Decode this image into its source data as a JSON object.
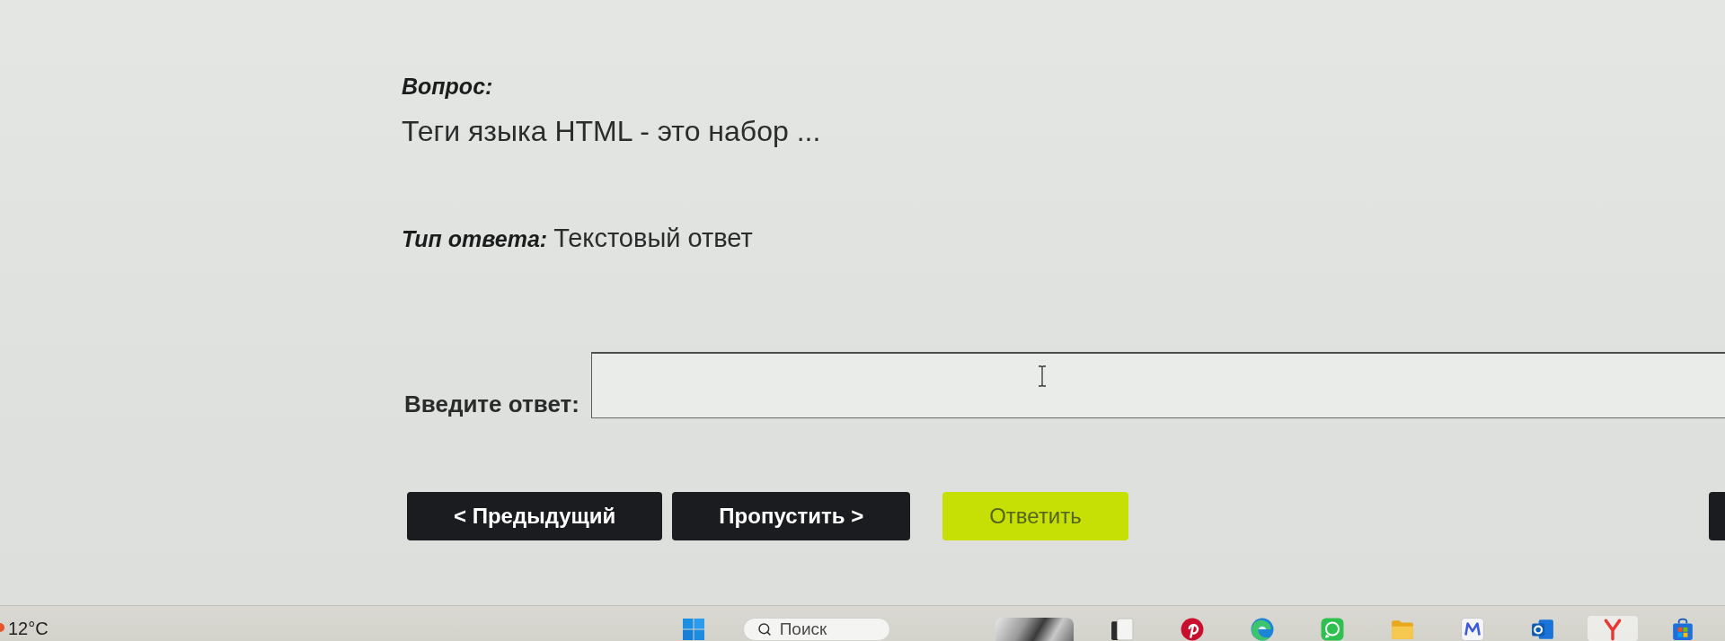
{
  "question": {
    "label": "Вопрос:",
    "text": "Теги языка HTML - это набор ..."
  },
  "answer_type": {
    "label": "Тип ответа:",
    "value": "Текстовый ответ"
  },
  "answer_input": {
    "label": "Введите ответ:"
  },
  "buttons": [
    {
      "label": "< Предыдущий",
      "kind": "primary"
    },
    {
      "label": "Пропустить >",
      "kind": "primary"
    },
    {
      "label": "Ответить",
      "kind": "accent"
    }
  ],
  "edge_button": {
    "kind": "primary"
  },
  "taskbar": {
    "weather": "12°C",
    "search": {
      "placeholder": "Поиск"
    },
    "apps": [
      {
        "active": false
      },
      {
        "active": false
      },
      {
        "active": false
      },
      {
        "active": false
      },
      {
        "active": false
      },
      {
        "active": false
      },
      {
        "active": false
      },
      {
        "active": true
      },
      {
        "active": false
      }
    ]
  }
}
